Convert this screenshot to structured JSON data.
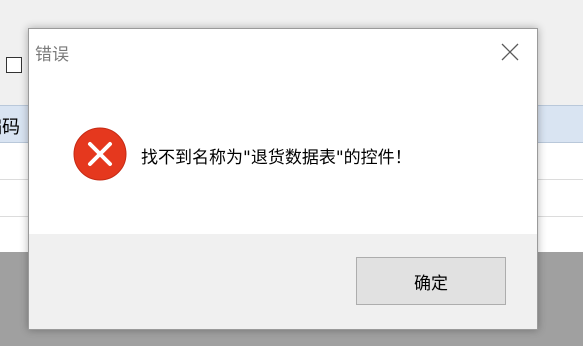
{
  "background_window": {
    "grid_header_label": "编码"
  },
  "dialog": {
    "title": "错误",
    "message": "找不到名称为\"退货数据表\"的控件！",
    "ok_label": "确定"
  },
  "colors": {
    "error_icon": "#e5381e",
    "button_bg": "#e1e1e1",
    "footer_bg": "#f0f0f0",
    "grid_header_bg": "#d9e4f2"
  },
  "icons": {
    "close": "close-icon",
    "error": "error-icon"
  }
}
